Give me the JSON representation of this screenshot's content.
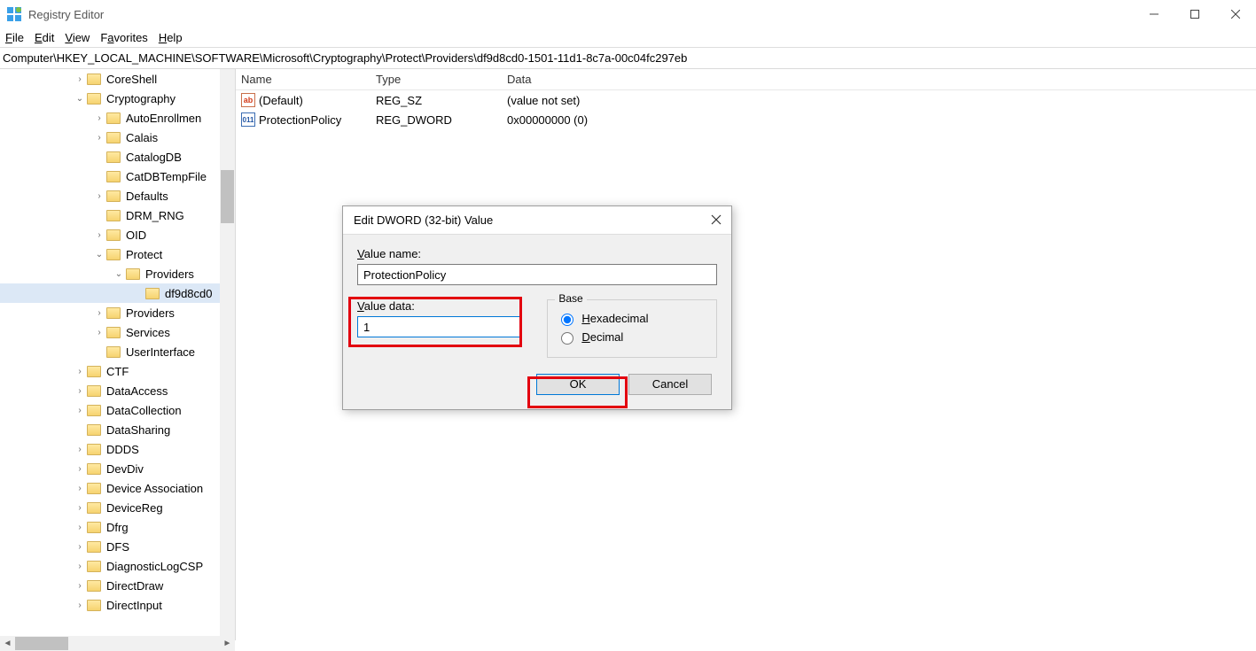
{
  "window": {
    "title": "Registry Editor"
  },
  "menu": {
    "file": "File",
    "edit": "Edit",
    "view": "View",
    "favorites": "Favorites",
    "help": "Help"
  },
  "address": "Computer\\HKEY_LOCAL_MACHINE\\SOFTWARE\\Microsoft\\Cryptography\\Protect\\Providers\\df9d8cd0-1501-11d1-8c7a-00c04fc297eb",
  "tree": [
    {
      "indent": 84,
      "exp": ">",
      "label": "CoreShell"
    },
    {
      "indent": 84,
      "exp": "v",
      "label": "Cryptography"
    },
    {
      "indent": 106,
      "exp": ">",
      "label": "AutoEnrollmen"
    },
    {
      "indent": 106,
      "exp": ">",
      "label": "Calais"
    },
    {
      "indent": 106,
      "exp": "",
      "label": "CatalogDB"
    },
    {
      "indent": 106,
      "exp": "",
      "label": "CatDBTempFile"
    },
    {
      "indent": 106,
      "exp": ">",
      "label": "Defaults"
    },
    {
      "indent": 106,
      "exp": "",
      "label": "DRM_RNG"
    },
    {
      "indent": 106,
      "exp": ">",
      "label": "OID"
    },
    {
      "indent": 106,
      "exp": "v",
      "label": "Protect"
    },
    {
      "indent": 128,
      "exp": "v",
      "label": "Providers"
    },
    {
      "indent": 150,
      "exp": "",
      "label": "df9d8cd0",
      "selected": true
    },
    {
      "indent": 106,
      "exp": ">",
      "label": "Providers"
    },
    {
      "indent": 106,
      "exp": ">",
      "label": "Services"
    },
    {
      "indent": 106,
      "exp": "",
      "label": "UserInterface"
    },
    {
      "indent": 84,
      "exp": ">",
      "label": "CTF"
    },
    {
      "indent": 84,
      "exp": ">",
      "label": "DataAccess"
    },
    {
      "indent": 84,
      "exp": ">",
      "label": "DataCollection"
    },
    {
      "indent": 84,
      "exp": "",
      "label": "DataSharing"
    },
    {
      "indent": 84,
      "exp": ">",
      "label": "DDDS"
    },
    {
      "indent": 84,
      "exp": ">",
      "label": "DevDiv"
    },
    {
      "indent": 84,
      "exp": ">",
      "label": "Device Association"
    },
    {
      "indent": 84,
      "exp": ">",
      "label": "DeviceReg"
    },
    {
      "indent": 84,
      "exp": ">",
      "label": "Dfrg"
    },
    {
      "indent": 84,
      "exp": ">",
      "label": "DFS"
    },
    {
      "indent": 84,
      "exp": ">",
      "label": "DiagnosticLogCSP"
    },
    {
      "indent": 84,
      "exp": ">",
      "label": "DirectDraw"
    },
    {
      "indent": 84,
      "exp": ">",
      "label": "DirectInput"
    }
  ],
  "list": {
    "headers": {
      "name": "Name",
      "type": "Type",
      "data": "Data"
    },
    "rows": [
      {
        "icon": "ab",
        "name": "(Default)",
        "type": "REG_SZ",
        "data": "(value not set)"
      },
      {
        "icon": "bin",
        "name": "ProtectionPolicy",
        "type": "REG_DWORD",
        "data": "0x00000000 (0)"
      }
    ]
  },
  "dialog": {
    "title": "Edit DWORD (32-bit) Value",
    "value_name_label": "Value name:",
    "value_name": "ProtectionPolicy",
    "value_data_label": "Value data:",
    "value_data": "1",
    "base_label": "Base",
    "hex_label": "Hexadecimal",
    "dec_label": "Decimal",
    "ok": "OK",
    "cancel": "Cancel"
  }
}
